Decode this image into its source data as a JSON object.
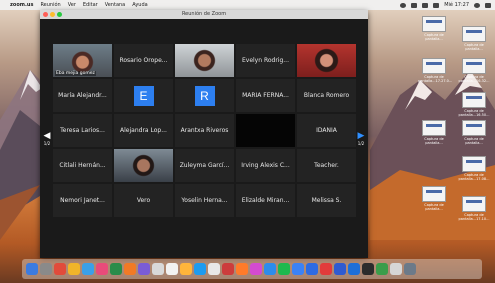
{
  "menubar": {
    "app_name": "zoom.us",
    "items": [
      "Reunión",
      "Ver",
      "Editar",
      "Ventana",
      "Ayuda"
    ],
    "clock": "Mié 17:27"
  },
  "window": {
    "title": "Reunión de Zoom",
    "page_left": "1/2",
    "page_right": "1/2"
  },
  "participants": [
    {
      "label": "",
      "caption": "Eba mejia gomez",
      "kind": "video",
      "active": true
    },
    {
      "label": "Rosario Orope...",
      "kind": "name"
    },
    {
      "label": "",
      "kind": "video"
    },
    {
      "label": "Evelyn Rodrig...",
      "kind": "name"
    },
    {
      "label": "",
      "kind": "video"
    },
    {
      "label": "María Alejandr...",
      "kind": "name"
    },
    {
      "label": "E",
      "kind": "avatar",
      "color": "#2d7ff0"
    },
    {
      "label": "R",
      "kind": "avatar",
      "color": "#2d7ff0"
    },
    {
      "label": "MARIA FERNA...",
      "kind": "name"
    },
    {
      "label": "Blanca Romero",
      "kind": "name"
    },
    {
      "label": "Teresa Larios...",
      "kind": "name"
    },
    {
      "label": "Alejandra Lop...",
      "kind": "name"
    },
    {
      "label": "Arantxa Riveros",
      "kind": "name"
    },
    {
      "label": "",
      "kind": "blank"
    },
    {
      "label": "IDANIA",
      "kind": "name"
    },
    {
      "label": "Citlali Hernán...",
      "kind": "name"
    },
    {
      "label": "",
      "kind": "video"
    },
    {
      "label": "Zuleyma Garcí...",
      "kind": "name"
    },
    {
      "label": "Irving Alexis C...",
      "kind": "name"
    },
    {
      "label": "Teacher.",
      "kind": "name"
    },
    {
      "label": "Nemori Janet...",
      "kind": "name"
    },
    {
      "label": "Vero",
      "kind": "name"
    },
    {
      "label": "Yoselin Herna...",
      "kind": "name"
    },
    {
      "label": "Elizalde Miran...",
      "kind": "name"
    },
    {
      "label": "Melissa S.",
      "kind": "name"
    }
  ],
  "desktop_icons": [
    "Captura de pantalla...",
    "Captura de pantalla...",
    "Captura de pantalla...17.27.0...",
    "Captura de pantalla...16.32...",
    "Captura de pantalla...16.50...",
    "Captura de pantalla...",
    "Captura de pantalla...",
    "Captura de pantalla...17.08...",
    "Captura de pantalla...",
    "Captura de pantalla...17.10..."
  ],
  "colors": {
    "accent_speaker": "#e6d84a",
    "avatar_blue": "#2d7ff0",
    "window_bg": "#1a1a1a"
  }
}
